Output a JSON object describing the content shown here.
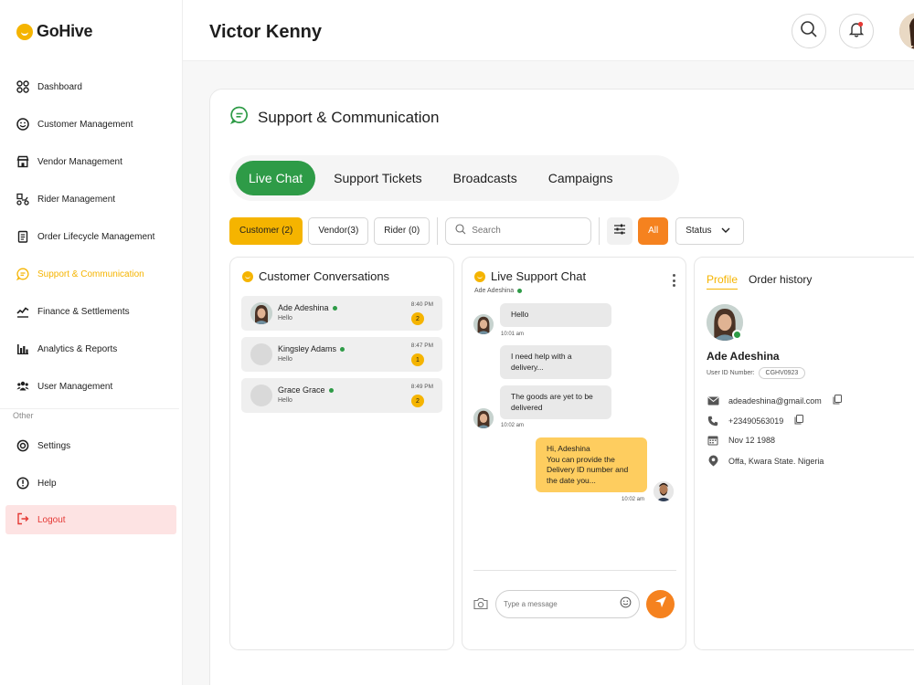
{
  "brand": {
    "name": "GoHive"
  },
  "sidebar": {
    "items": [
      {
        "label": "Dashboard"
      },
      {
        "label": "Customer Management"
      },
      {
        "label": "Vendor Management"
      },
      {
        "label": "Rider Management"
      },
      {
        "label": "Order Lifecycle Management"
      },
      {
        "label": "Support & Communication"
      },
      {
        "label": "Finance & Settlements"
      },
      {
        "label": "Analytics & Reports"
      },
      {
        "label": "User Management"
      }
    ],
    "other_label": "Other",
    "other_items": [
      {
        "label": "Settings"
      },
      {
        "label": "Help"
      }
    ],
    "logout_label": "Logout"
  },
  "header": {
    "user_name": "Victor Kenny"
  },
  "section": {
    "title": "Support & Communication"
  },
  "tabs": [
    {
      "label": "Live Chat"
    },
    {
      "label": "Support Tickets"
    },
    {
      "label": "Broadcasts"
    },
    {
      "label": "Campaigns"
    }
  ],
  "filters": {
    "chips": [
      {
        "label": "Customer (2)"
      },
      {
        "label": "Vendor(3)"
      },
      {
        "label": "Rider (0)"
      }
    ],
    "search_placeholder": "Search",
    "all_label": "All",
    "status_label": "Status"
  },
  "conversations": {
    "title": "Customer Conversations",
    "items": [
      {
        "name": "Ade Adeshina",
        "message": "Hello",
        "time": "8:40 PM",
        "count": "2"
      },
      {
        "name": "Kingsley Adams",
        "message": "Hello",
        "time": "8:47 PM",
        "count": "1"
      },
      {
        "name": "Grace Grace",
        "message": "Hello",
        "time": "8:49 PM",
        "count": "2"
      }
    ]
  },
  "chat": {
    "title": "Live Support Chat",
    "subtitle": "Ade Adeshina",
    "messages": [
      {
        "text": "Hello",
        "time": "10:01 am"
      },
      {
        "text": "I need help with a delivery..."
      },
      {
        "text": "The goods are yet to be delivered",
        "time": "10:02 am"
      },
      {
        "text": "Hi, Adeshina\nYou can provide the Delivery ID number and the date you...",
        "time": "10:02 am"
      }
    ],
    "input_placeholder": "Type a message"
  },
  "profile": {
    "tabs": [
      {
        "label": "Profile"
      },
      {
        "label": "Order history"
      }
    ],
    "name": "Ade Adeshina",
    "user_id_label": "User ID Number:",
    "user_id": "CGHV0923",
    "email": "adeadeshina@gmail.com",
    "phone": "+23490563019",
    "dob": "Nov 12 1988",
    "address": "Offa, Kwara State. Nigeria"
  },
  "colors": {
    "brand_yellow": "#f5b400",
    "green": "#2e9b47",
    "orange": "#f5821f",
    "logout_bg": "#fde3e3",
    "logout_text": "#e53935"
  }
}
